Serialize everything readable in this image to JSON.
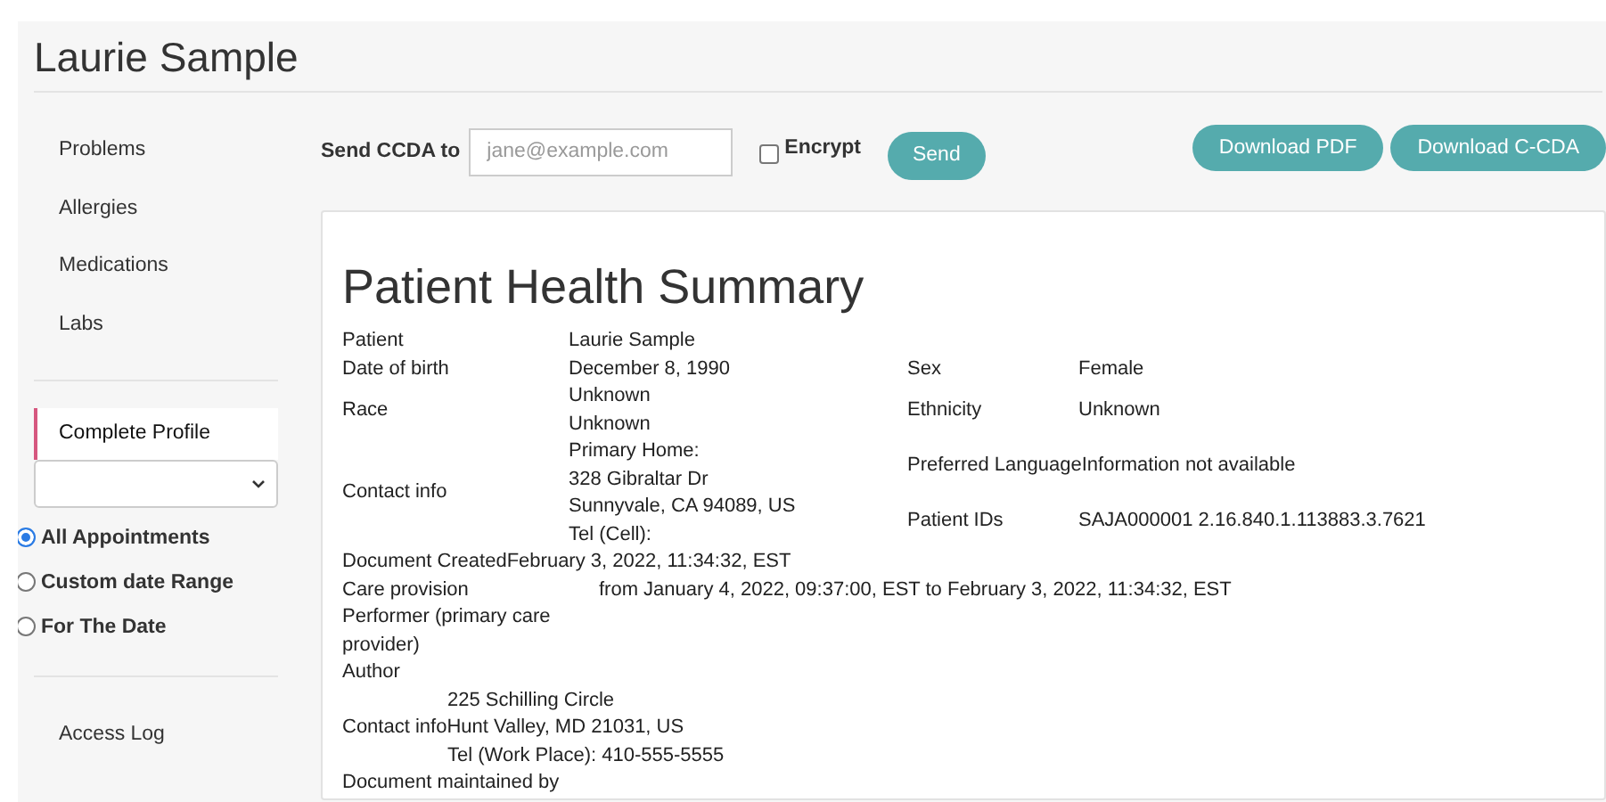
{
  "header": {
    "title": "Laurie Sample"
  },
  "sidebar": {
    "items": [
      {
        "label": "Problems"
      },
      {
        "label": "Allergies"
      },
      {
        "label": "Medications"
      },
      {
        "label": "Labs"
      }
    ],
    "profile": {
      "label": "Complete Profile",
      "selected": true
    },
    "filters": [
      {
        "label": "All Appointments",
        "selected": true
      },
      {
        "label": "Custom date Range",
        "selected": false
      },
      {
        "label": "For The Date",
        "selected": false
      }
    ],
    "footer_link": "Access Log"
  },
  "send_form": {
    "label": "Send CCDA to",
    "placeholder": "jane@example.com",
    "encrypt": {
      "label": "Encrypt",
      "checked": false
    },
    "button": "Send"
  },
  "downloads": [
    "Download PDF",
    "Download C-CDA"
  ],
  "document": {
    "title": "Patient Health Summary",
    "demographics": [
      {
        "label": "Patient",
        "lines": [
          "Laurie Sample"
        ]
      },
      {
        "label": "Date of birth",
        "lines": [
          "December 8, 1990"
        ],
        "side": [
          {
            "label": "Sex",
            "value": "Female"
          }
        ]
      },
      {
        "label": "Race",
        "lines": [
          "Unknown",
          "Unknown"
        ],
        "side": [
          {
            "label": "Ethnicity",
            "value": "Unknown"
          }
        ]
      },
      {
        "label": "Contact info",
        "lines": [
          "Primary Home:",
          "328 Gibraltar Dr",
          "Sunnyvale, CA 94089, US",
          "Tel (Cell):"
        ],
        "side": [
          {
            "label": "Preferred Language",
            "value": "Information not available"
          },
          {
            "label": "Patient IDs",
            "value": "SAJA000001 2.16.840.1.113883.3.7621"
          }
        ]
      }
    ],
    "details": [
      {
        "kind": "inline",
        "label": "Document Created",
        "value": "February 3, 2022, 11:34:32, EST"
      },
      {
        "kind": "wide",
        "label": "Care provision",
        "value": "from January 4, 2022, 09:37:00, EST to February 3, 2022, 11:34:32, EST"
      },
      {
        "kind": "heading",
        "label": "Performer (primary care provider)"
      },
      {
        "kind": "heading",
        "label": "Author"
      },
      {
        "kind": "line",
        "value": "225 Schilling Circle"
      },
      {
        "kind": "inline",
        "label": "Contact info",
        "value": "Hunt Valley, MD 21031, US"
      },
      {
        "kind": "line",
        "value": "Tel (Work Place): 410-555-5555"
      },
      {
        "kind": "heading",
        "label": "Document maintained by"
      }
    ]
  }
}
